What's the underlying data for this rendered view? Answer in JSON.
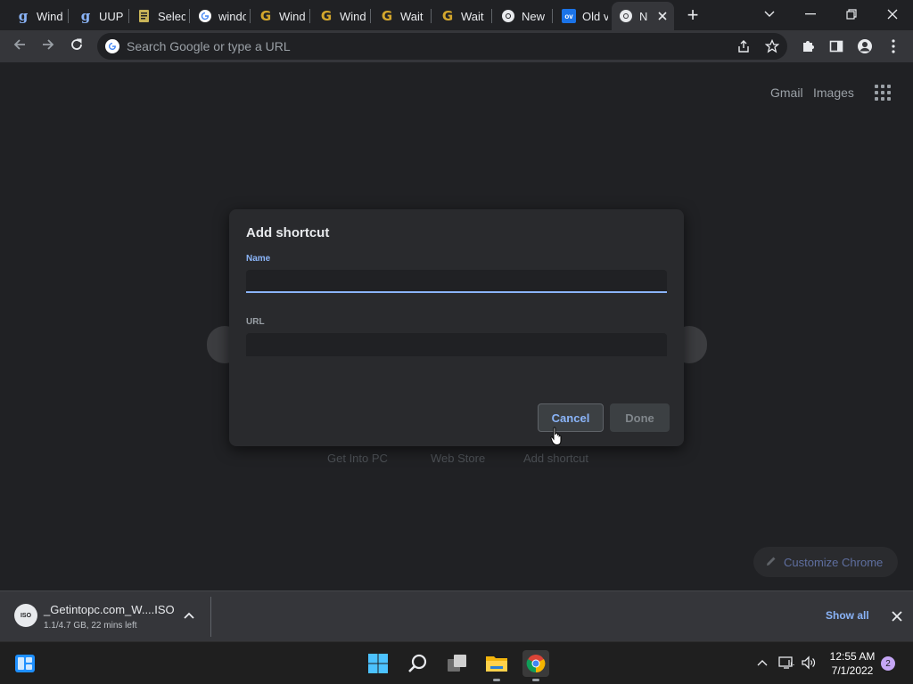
{
  "tabs": [
    {
      "title": "Wind",
      "favicon": "g-icon"
    },
    {
      "title": "UUP",
      "favicon": "g-icon"
    },
    {
      "title": "Selec",
      "favicon": "doc-icon"
    },
    {
      "title": "windo",
      "favicon": "google-icon"
    },
    {
      "title": "Wind",
      "favicon": "G-icon"
    },
    {
      "title": "Wind",
      "favicon": "G-icon"
    },
    {
      "title": "Wait",
      "favicon": "G-icon"
    },
    {
      "title": "Wait",
      "favicon": "G-icon"
    },
    {
      "title": "New",
      "favicon": "chrome-icon"
    },
    {
      "title": "Old v",
      "favicon": "ov-icon"
    },
    {
      "title": "N",
      "favicon": "chrome-icon",
      "active": true
    }
  ],
  "tab_icons": {
    "g": "g",
    "G": "G",
    "ov": "ov"
  },
  "new_tab_label": "+",
  "omnibox": {
    "placeholder": "Search Google or type a URL"
  },
  "top_links": {
    "gmail": "Gmail",
    "images": "Images"
  },
  "shortcuts": [
    "Get Into PC",
    "Web Store",
    "Add shortcut"
  ],
  "customize_label": "Customize Chrome",
  "dialog": {
    "title": "Add shortcut",
    "name_label": "Name",
    "name_value": "",
    "url_label": "URL",
    "url_value": "",
    "cancel_label": "Cancel",
    "done_label": "Done"
  },
  "download": {
    "icon_text": "ISO",
    "filename": "_Getintopc.com_W....ISO",
    "status": "1.1/4.7 GB, 22 mins left",
    "show_all_label": "Show all"
  },
  "clock": {
    "time": "12:55 AM",
    "date": "7/1/2022"
  },
  "notification_count": "2",
  "colors": {
    "accent": "#8ab4f8",
    "background": "#202124",
    "toolbar": "#35363a"
  }
}
